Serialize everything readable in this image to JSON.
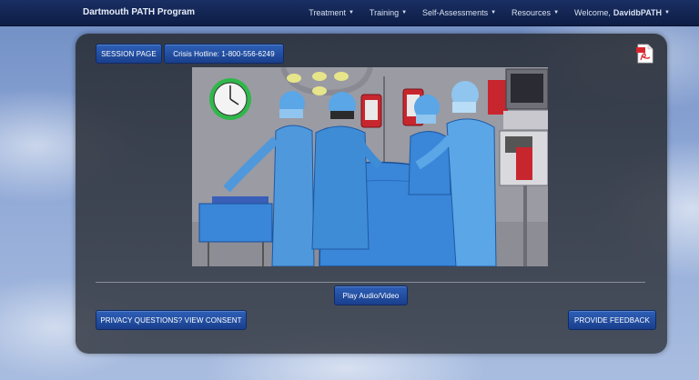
{
  "navbar": {
    "brand": "Dartmouth PATH Program",
    "items": [
      {
        "label": "Treatment"
      },
      {
        "label": "Training"
      },
      {
        "label": "Self-Assessments"
      },
      {
        "label": "Resources"
      }
    ],
    "welcome_prefix": "Welcome,",
    "welcome_user": "DavidbPATH"
  },
  "panel": {
    "session_label": "SESSION PAGE",
    "hotline_label": "Crisis Hotline: 1-800-556-6249",
    "pdf_icon": "pdf-icon",
    "illustration_icon": "surgery-illustration",
    "play_label": "Play Audio/Video",
    "privacy_label": "PRIVACY QUESTIONS? VIEW CONSENT",
    "feedback_label": "PROVIDE FEEDBACK"
  },
  "colors": {
    "nav_bg": "#0d1d45",
    "button_bg": "#1a3f8c",
    "panel_bg": "#2c3038",
    "drape_blue": "#3a86d8",
    "scrub_blue": "#5aa6e6"
  }
}
